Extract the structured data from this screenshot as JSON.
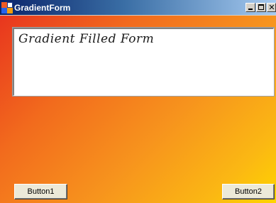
{
  "window": {
    "title": "GradientForm",
    "icon": "app-form-icon",
    "controls": {
      "minimize": "minimize-icon",
      "maximize": "maximize-icon",
      "close_glyph": "✕"
    }
  },
  "client": {
    "gradient_colors": [
      "#e8361e",
      "#f7941d",
      "#ffd400"
    ],
    "textbox": {
      "value": "Gradient Filled Form"
    },
    "buttons": {
      "button1_label": "Button1",
      "button2_label": "Button2"
    }
  }
}
